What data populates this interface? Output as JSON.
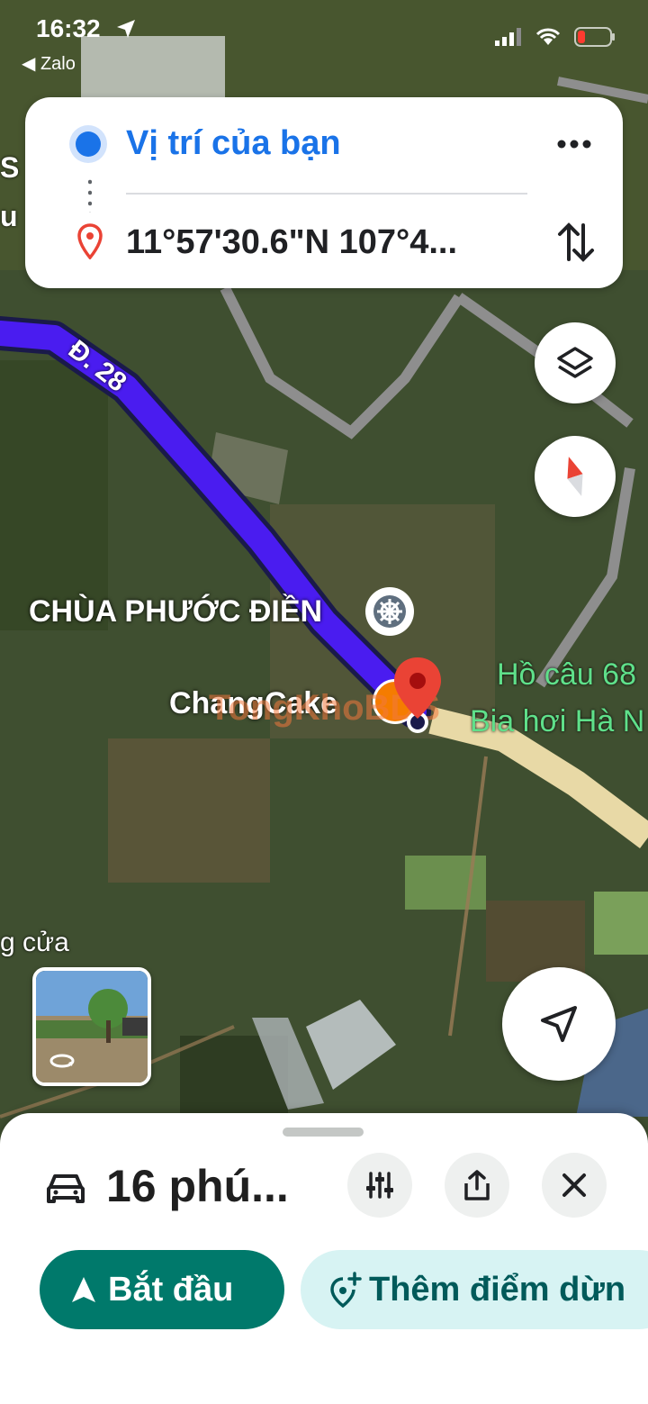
{
  "status_bar": {
    "time": "16:32",
    "back_app": "Zalo"
  },
  "route_card": {
    "origin": "Vị trí của bạn",
    "destination": "11°57'30.6\"N 107°4..."
  },
  "map_labels": {
    "road": "Đ. 28",
    "temple": "CHÙA PHƯỚC ĐIỀN",
    "shop": "ChangCake",
    "poi1": "Hồ câu 68",
    "poi2": "Bia hơi Hà N",
    "left_edge_1": "S",
    "left_edge_2": "u",
    "left_edge_3": "g cửa",
    "watermark": "TongKhoBDS"
  },
  "sheet": {
    "eta": "16 phú...",
    "start_label": "Bắt đầu",
    "add_stop_label": "Thêm điểm dừn"
  },
  "colors": {
    "route": "#4a1cf0",
    "accent": "#00796b",
    "origin_blue": "#1a73e8",
    "pin_red": "#ea4335"
  }
}
